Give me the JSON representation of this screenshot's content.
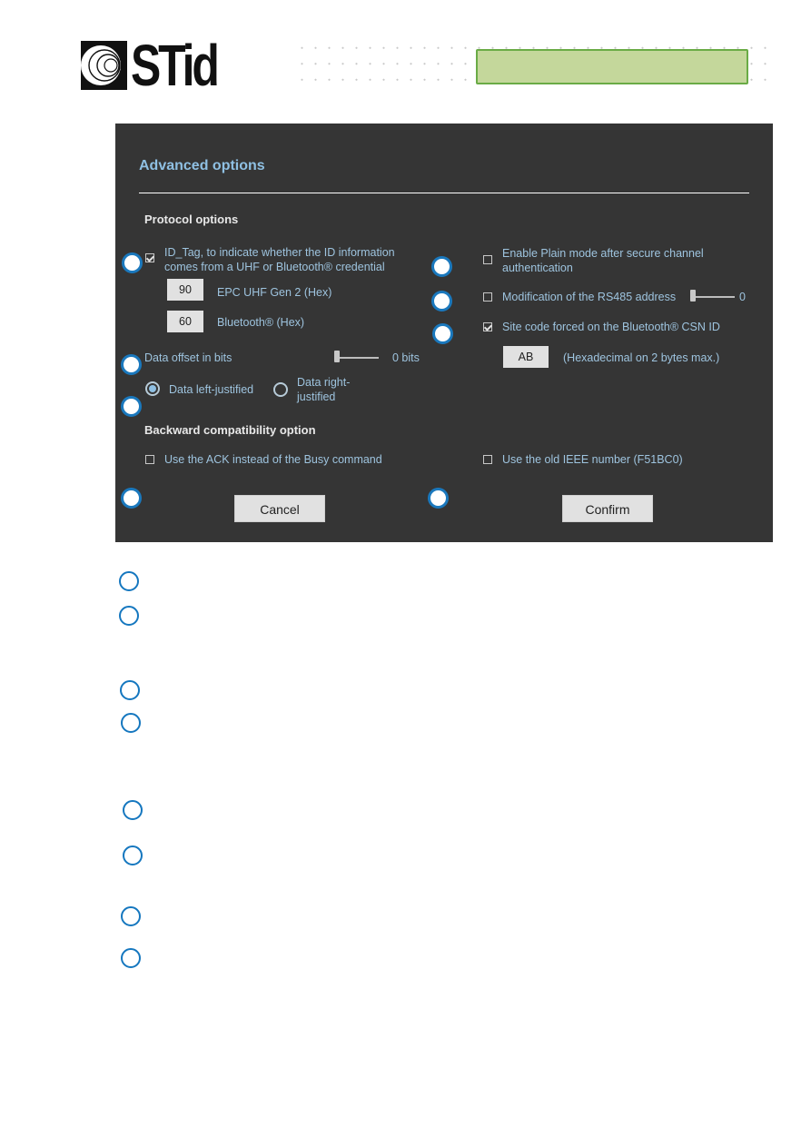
{
  "header": {
    "logo_text": "STid",
    "accent_colors": {
      "green_fill": "#c4d79b",
      "green_border": "#6aab46",
      "callout_blue": "#1a78bd"
    }
  },
  "dialog": {
    "title": "Advanced options",
    "protocol_section": "Protocol options",
    "id_tag": {
      "label_line1": "ID_Tag, to indicate whether the ID information",
      "label_line2": "comes from a UHF or Bluetooth® credential",
      "checked": true
    },
    "epc_field": {
      "value": "90",
      "label": "EPC UHF Gen 2 (Hex)"
    },
    "bluetooth_field": {
      "value": "60",
      "label": "Bluetooth® (Hex)"
    },
    "data_offset": {
      "label": "Data offset in bits",
      "value": "0 bits",
      "slider_value": 0
    },
    "justify": {
      "left_label": "Data left-justified",
      "right_label_line1": "Data right-",
      "right_label_line2": "justified",
      "selected": "left"
    },
    "plain_mode": {
      "label_line1": "Enable Plain mode after secure channel",
      "label_line2": "authentication",
      "checked": false
    },
    "rs485": {
      "label": "Modification of the RS485 address",
      "value": "0",
      "checked": false
    },
    "site_code": {
      "label": "Site code forced on the Bluetooth® CSN ID",
      "checked": true,
      "field_value": "AB",
      "hint": "(Hexadecimal on 2 bytes max.)"
    },
    "backward_section": "Backward compatibility option",
    "ack_option": {
      "label": "Use the ACK instead of the Busy command",
      "checked": false
    },
    "ieee_option": {
      "label": "Use the old IEEE number (F51BC0)",
      "checked": false
    },
    "cancel_label": "Cancel",
    "confirm_label": "Confirm"
  },
  "legend": {
    "callout_count": 8
  }
}
